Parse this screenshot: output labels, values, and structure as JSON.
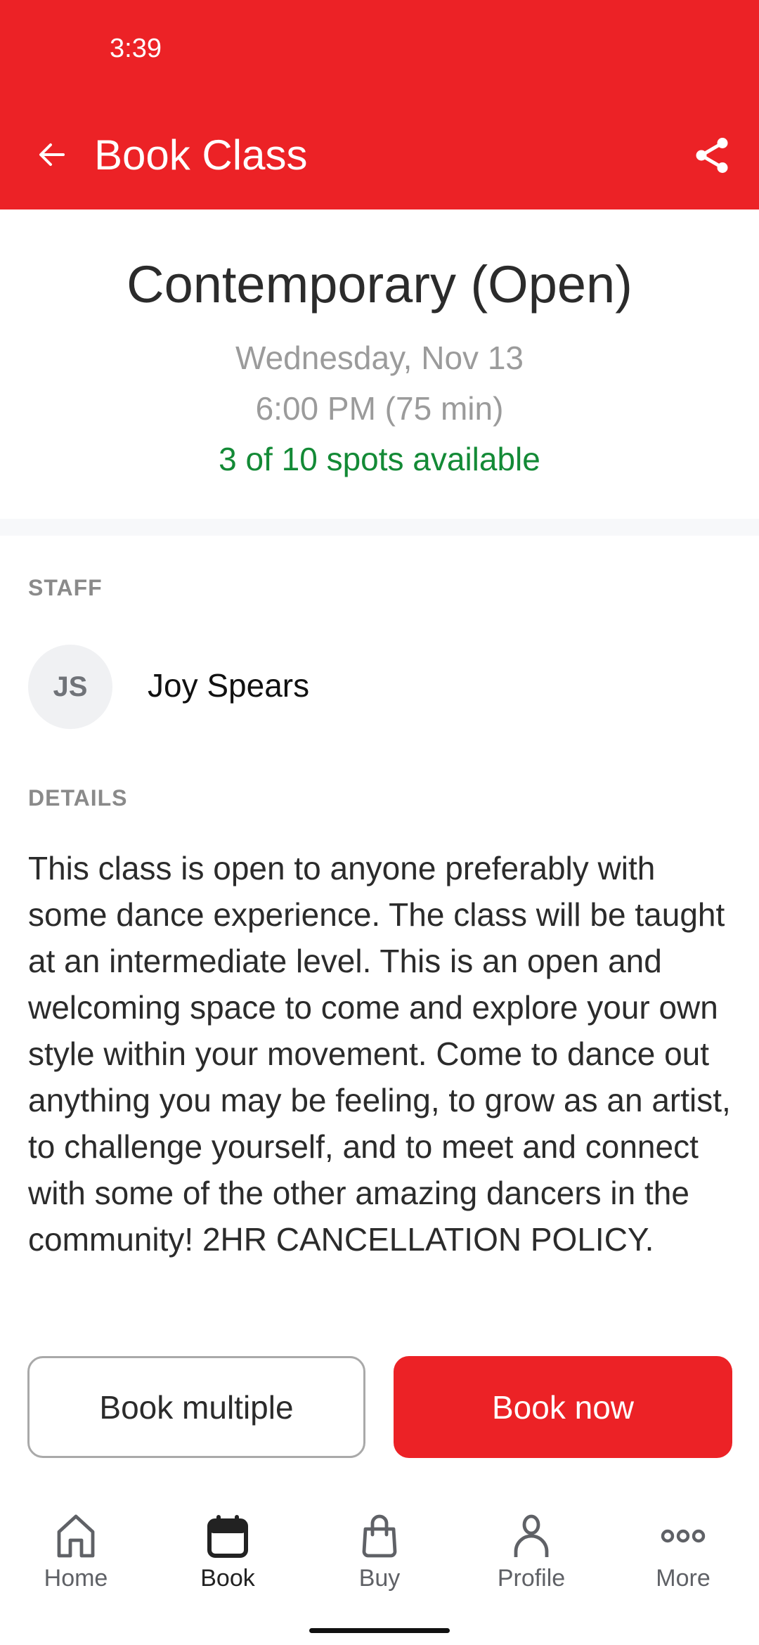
{
  "status_bar": {
    "time": "3:39"
  },
  "app_bar": {
    "title": "Book Class",
    "back_icon": "arrow-left-icon",
    "share_icon": "share-icon"
  },
  "class_info": {
    "title": "Contemporary (Open)",
    "date": "Wednesday, Nov 13",
    "time": "6:00 PM (75 min)",
    "spots": "3 of 10 spots available"
  },
  "staff": {
    "section_label": "STAFF",
    "initials": "JS",
    "name": "Joy Spears"
  },
  "details": {
    "section_label": "DETAILS",
    "text": "This class is open to anyone preferably with some dance experience. The class will be taught at an intermediate level. This is an open and welcoming space to come and explore your own style within your movement. Come to dance out anything you may be feeling, to grow as an artist, to challenge yourself, and to meet and connect with some of the other amazing dancers in the community! 2HR CANCELLATION POLICY."
  },
  "actions": {
    "book_multiple": "Book multiple",
    "book_now": "Book now"
  },
  "bottom_nav": {
    "items": [
      {
        "label": "Home",
        "icon": "home-icon",
        "active": false
      },
      {
        "label": "Book",
        "icon": "calendar-icon",
        "active": true
      },
      {
        "label": "Buy",
        "icon": "shopping-bag-icon",
        "active": false
      },
      {
        "label": "Profile",
        "icon": "person-icon",
        "active": false
      },
      {
        "label": "More",
        "icon": "more-dots-icon",
        "active": false
      }
    ]
  },
  "colors": {
    "brand_red": "#ec2226",
    "spots_green": "#138a36",
    "muted_gray": "#9b9b9b"
  }
}
